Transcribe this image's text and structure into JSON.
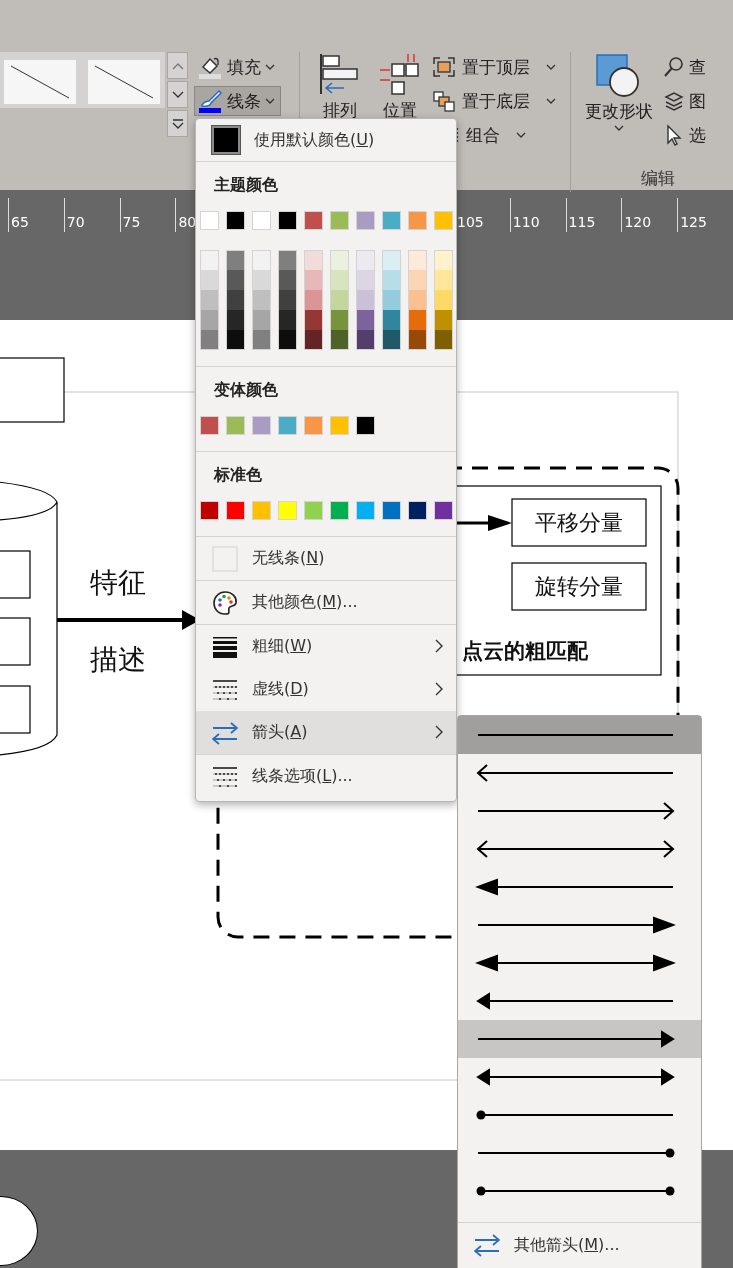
{
  "ribbon": {
    "style_buttons": [
      {
        "label": "填充",
        "pressed": false
      },
      {
        "label": "线条",
        "pressed": true
      }
    ],
    "arrange_buttons": [
      {
        "label": "排列"
      },
      {
        "label": "位置"
      }
    ],
    "order_buttons": [
      {
        "label": "置于顶层"
      },
      {
        "label": "置于底层"
      },
      {
        "label": "组合"
      }
    ],
    "change_shape": {
      "label": "更改形状"
    },
    "edit_buttons": [
      {
        "label": "查"
      },
      {
        "label": "图"
      },
      {
        "label": "选"
      }
    ],
    "group_label": "编辑"
  },
  "ruler": {
    "left_labels": [
      "65",
      "70",
      "75",
      "80"
    ],
    "right_labels": [
      "105",
      "110",
      "115",
      "120",
      "125"
    ]
  },
  "slide": {
    "labels": [
      "特征",
      "描述"
    ],
    "boxes": [
      "平移分量",
      "旋转分量"
    ],
    "caption": "点云的粗匹配"
  },
  "line_menu": {
    "default_color": {
      "before": "使用默认颜色(",
      "hotkey": "U",
      "after": ")"
    },
    "theme_title": "主题颜色",
    "theme_colors": [
      {
        "color": "#ffffff"
      },
      {
        "color": "#000000"
      },
      {
        "color": "#ffffff"
      },
      {
        "color": "#000000"
      },
      {
        "color": "#c0504d"
      },
      {
        "color": "#9bbb59"
      },
      {
        "color": "#a99bc1"
      },
      {
        "color": "#4bacc6"
      },
      {
        "color": "#f79646"
      },
      {
        "color": "#ffc000"
      }
    ],
    "theme_shades": [
      {
        "shades": [
          {
            "color": "#f2f2f2"
          },
          {
            "color": "#d9d9d9"
          },
          {
            "color": "#bfbfbf"
          },
          {
            "color": "#a6a6a6"
          },
          {
            "color": "#808080"
          }
        ]
      },
      {
        "shades": [
          {
            "color": "#7f7f7f"
          },
          {
            "color": "#595959"
          },
          {
            "color": "#404040"
          },
          {
            "color": "#262626"
          },
          {
            "color": "#0d0d0d"
          }
        ]
      },
      {
        "shades": [
          {
            "color": "#f2f2f2"
          },
          {
            "color": "#d9d9d9"
          },
          {
            "color": "#bfbfbf"
          },
          {
            "color": "#a6a6a6"
          },
          {
            "color": "#808080"
          }
        ]
      },
      {
        "shades": [
          {
            "color": "#7f7f7f"
          },
          {
            "color": "#595959"
          },
          {
            "color": "#404040"
          },
          {
            "color": "#262626"
          },
          {
            "color": "#0d0d0d"
          }
        ]
      },
      {
        "shades": [
          {
            "color": "#f2dcdb"
          },
          {
            "color": "#e6b9b8"
          },
          {
            "color": "#da9694"
          },
          {
            "color": "#953735"
          },
          {
            "color": "#632523"
          }
        ]
      },
      {
        "shades": [
          {
            "color": "#ebf1de"
          },
          {
            "color": "#d7e4bd"
          },
          {
            "color": "#c3d69b"
          },
          {
            "color": "#77933c"
          },
          {
            "color": "#4f6228"
          }
        ]
      },
      {
        "shades": [
          {
            "color": "#ece9f1"
          },
          {
            "color": "#dcd6e4"
          },
          {
            "color": "#cbc0d9"
          },
          {
            "color": "#7c639c"
          },
          {
            "color": "#533f6a"
          }
        ]
      },
      {
        "shades": [
          {
            "color": "#dbeef4"
          },
          {
            "color": "#b7dee8"
          },
          {
            "color": "#93cddd"
          },
          {
            "color": "#31859c"
          },
          {
            "color": "#215968"
          }
        ]
      },
      {
        "shades": [
          {
            "color": "#fdeada"
          },
          {
            "color": "#fcd5b5"
          },
          {
            "color": "#fac090"
          },
          {
            "color": "#e46c0a"
          },
          {
            "color": "#984807"
          }
        ]
      },
      {
        "shades": [
          {
            "color": "#fff2cc"
          },
          {
            "color": "#ffe699"
          },
          {
            "color": "#ffd966"
          },
          {
            "color": "#bf9000"
          },
          {
            "color": "#7f6000"
          }
        ]
      }
    ],
    "variant_title": "变体颜色",
    "variant_colors": [
      {
        "color": "#c0504d"
      },
      {
        "color": "#9bbb59"
      },
      {
        "color": "#a99bc1"
      },
      {
        "color": "#4bacc6"
      },
      {
        "color": "#f79646"
      },
      {
        "color": "#ffc000"
      },
      {
        "color": "#000000"
      }
    ],
    "standard_title": "标准色",
    "standard_colors": [
      {
        "color": "#c00000"
      },
      {
        "color": "#ff0000"
      },
      {
        "color": "#ffc000"
      },
      {
        "color": "#ffff00"
      },
      {
        "color": "#92d050"
      },
      {
        "color": "#00b050"
      },
      {
        "color": "#00b0f0"
      },
      {
        "color": "#0070c0"
      },
      {
        "color": "#002060"
      },
      {
        "color": "#7030a0"
      }
    ],
    "items": [
      {
        "before": "无线条(",
        "hotkey": "N",
        "after": ")",
        "submenu": false,
        "highlighted": false,
        "divider_above": true
      },
      {
        "before": "其他颜色(",
        "hotkey": "M",
        "after": ")...",
        "submenu": false,
        "highlighted": false,
        "divider_above": true
      },
      {
        "before": "粗细(",
        "hotkey": "W",
        "after": ")",
        "submenu": true,
        "highlighted": false,
        "divider_above": true
      },
      {
        "before": "虚线(",
        "hotkey": "D",
        "after": ")",
        "submenu": true,
        "highlighted": false,
        "divider_above": false
      },
      {
        "before": "箭头(",
        "hotkey": "A",
        "after": ")",
        "submenu": true,
        "highlighted": true,
        "divider_above": false
      },
      {
        "before": "线条选项(",
        "hotkey": "L",
        "after": ")...",
        "submenu": false,
        "highlighted": false,
        "divider_above": true
      }
    ]
  },
  "arrow_menu": {
    "styles": [
      {
        "kind": "plain",
        "selected": true,
        "highlighted": false
      },
      {
        "kind": "openleft",
        "selected": false,
        "highlighted": false
      },
      {
        "kind": "openright",
        "selected": false,
        "highlighted": false
      },
      {
        "kind": "openboth",
        "selected": false,
        "highlighted": false
      },
      {
        "kind": "triangleleft",
        "selected": false,
        "highlighted": false
      },
      {
        "kind": "triangleright",
        "selected": false,
        "highlighted": false
      },
      {
        "kind": "triangleboth",
        "selected": false,
        "highlighted": false
      },
      {
        "kind": "smallleft",
        "selected": false,
        "highlighted": false
      },
      {
        "kind": "smallright",
        "selected": false,
        "highlighted": true
      },
      {
        "kind": "smallboth",
        "selected": false,
        "highlighted": false
      },
      {
        "kind": "ovalleft",
        "selected": false,
        "highlighted": false
      },
      {
        "kind": "ovalright",
        "selected": false,
        "highlighted": false
      },
      {
        "kind": "ovalboth",
        "selected": false,
        "highlighted": false
      }
    ],
    "more": {
      "before": "其他箭头(",
      "hotkey": "M",
      "after": ")..."
    }
  }
}
